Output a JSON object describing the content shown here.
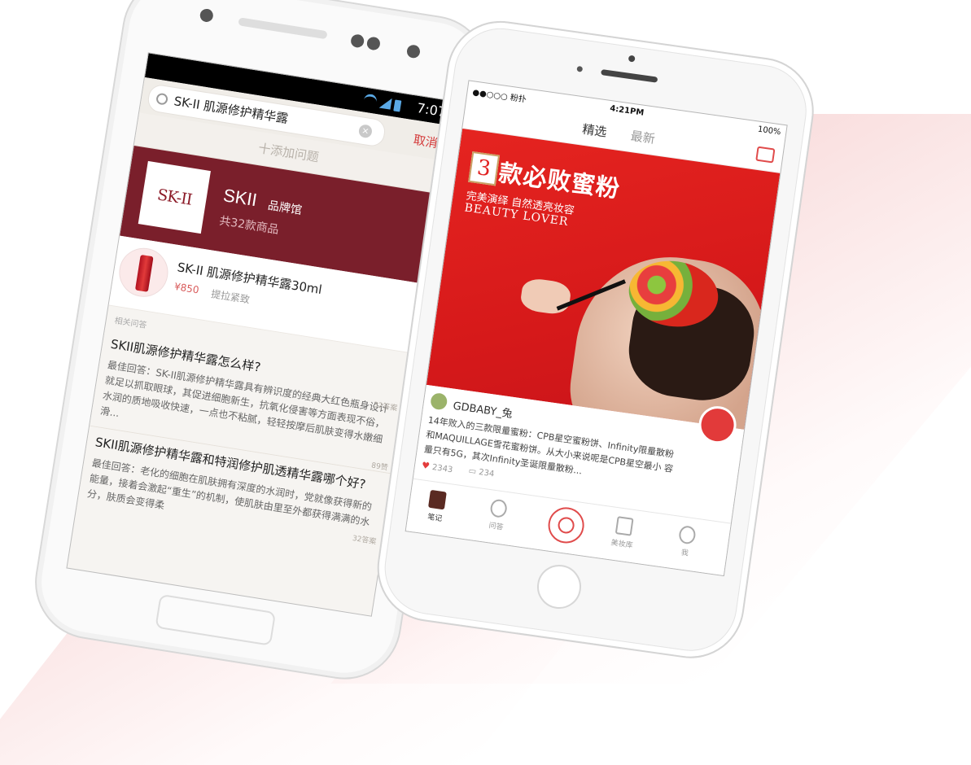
{
  "android": {
    "status_time": "7:07",
    "search_query": "SK-II 肌源修护精华露",
    "clear_icon": "×",
    "cancel_label": "取消",
    "add_question": "十添加问题",
    "brand": {
      "logo_text": "SK-II",
      "name": "SKII",
      "tag": "品牌馆",
      "count": "共32款商品"
    },
    "product": {
      "title": "SK-II 肌源修护精华露30ml",
      "price": "¥850",
      "feature": "提拉紧致"
    },
    "related_label": "相关问答",
    "qa": [
      {
        "question": "SKII肌源修护精华露怎么样?",
        "answer": "最佳回答：SK-II肌源修护精华露具有辨识度的经典大红色瓶身设计就足以抓取眼球，其促进细胞新生，抗氧化侵害等方面表现不俗，水润的质地吸收快速，一点也不粘腻，轻轻按摩后肌肤变得水嫩细滑...",
        "count": "32答案"
      },
      {
        "question": "SKII肌源修护精华露和特润修护肌透精华露哪个好?",
        "answer": "最佳回答：老化的细胞在肌肤拥有深度的水润时，党就像获得新的能量，接着会激起“重生”的机制，使肌肤由里至外都获得满满的水分，肤质会变得柔",
        "count": "89赞",
        "count2": "32答案"
      }
    ]
  },
  "iphone": {
    "carrier": "●●○○○ 粉扑 ",
    "time": "4:21PM",
    "battery": "100%",
    "nav_tabs": [
      "精选",
      "最新"
    ],
    "hero": {
      "number": "3",
      "headline": "款必败蜜粉",
      "subline": "完美演绎 自然透亮妆容",
      "english": "BEAUTY LOVER"
    },
    "post": {
      "user": "GDBABY_兔",
      "body": "14年败入的三款限量蜜粉：CPB星空蜜粉饼、Infinity限量散粉和MAQUILLAGE雪花蜜粉饼。从大小来说呢是CPB星空最小 容量只有5G，其次Infinity圣诞限量散粉...",
      "likes": "2343",
      "comments": "234"
    },
    "tabs": [
      "笔记",
      "问答",
      "美妆库",
      "我"
    ]
  },
  "colors": {
    "brand_red": "#7a1f2b",
    "accent_red": "#e04b4b",
    "hero_red": "#e52420"
  }
}
